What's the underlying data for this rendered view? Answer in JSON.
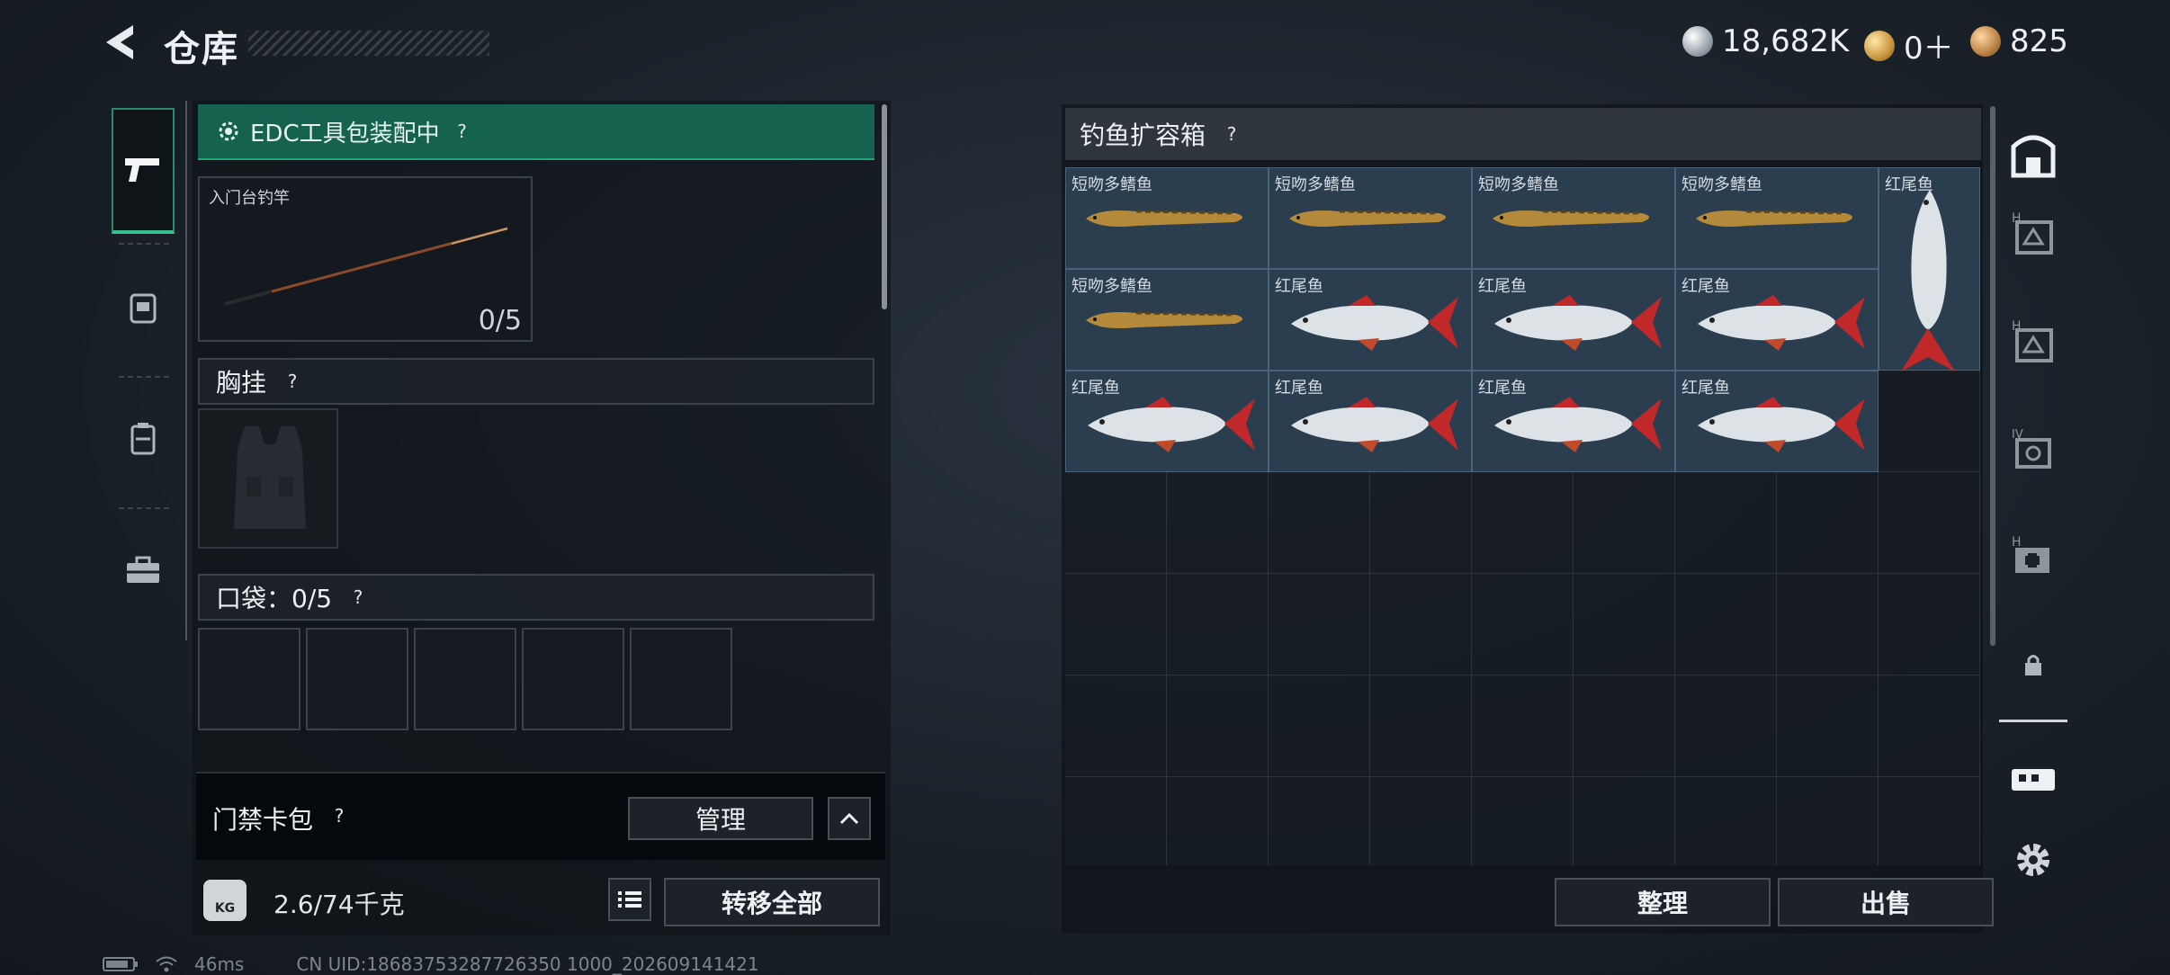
{
  "header": {
    "title": "仓库"
  },
  "currencies": [
    {
      "icon": "silver-coin-icon",
      "value": "18,682K"
    },
    {
      "icon": "gold-badge-icon",
      "value": "0＋"
    },
    {
      "icon": "bronze-coin-icon",
      "value": "825"
    }
  ],
  "loadout": {
    "edc_label": "EDC工具包装配中",
    "help": "?",
    "rod": {
      "label": "入门台钓竿",
      "count": "0/5"
    },
    "chest_rig": {
      "label": "胸挂",
      "help": "?"
    },
    "pocket": {
      "label": "口袋：0/5",
      "help": "?"
    },
    "card_pack": {
      "label": "门禁卡包",
      "help": "?",
      "manage": "管理"
    },
    "weight": {
      "icon_text": "KG",
      "value": "2.6/74千克"
    },
    "transfer_all": "转移全部"
  },
  "container": {
    "title": "钓鱼扩容箱",
    "help": "?",
    "items": [
      {
        "name": "短吻多鳍鱼",
        "type": "bichir"
      },
      {
        "name": "短吻多鳍鱼",
        "type": "bichir"
      },
      {
        "name": "短吻多鳍鱼",
        "type": "bichir"
      },
      {
        "name": "短吻多鳍鱼",
        "type": "bichir"
      },
      {
        "name": "红尾鱼",
        "type": "redtail-vertical"
      },
      {
        "name": "短吻多鳍鱼",
        "type": "bichir"
      },
      {
        "name": "红尾鱼",
        "type": "redtail"
      },
      {
        "name": "红尾鱼",
        "type": "redtail"
      },
      {
        "name": "红尾鱼",
        "type": "redtail"
      },
      {
        "name": "红尾鱼",
        "type": "redtail"
      },
      {
        "name": "红尾鱼",
        "type": "redtail"
      },
      {
        "name": "红尾鱼",
        "type": "redtail"
      },
      {
        "name": "红尾鱼",
        "type": "redtail"
      }
    ],
    "sort_button": "整理",
    "sell_button": "出售"
  },
  "status": {
    "ping": "46ms",
    "uid": "CN UID:18683753287726350 1000_202609141421"
  },
  "colors": {
    "accent_green": "#15624f",
    "item_bg": "#2b3e50",
    "fish_red": "#c0282a"
  }
}
